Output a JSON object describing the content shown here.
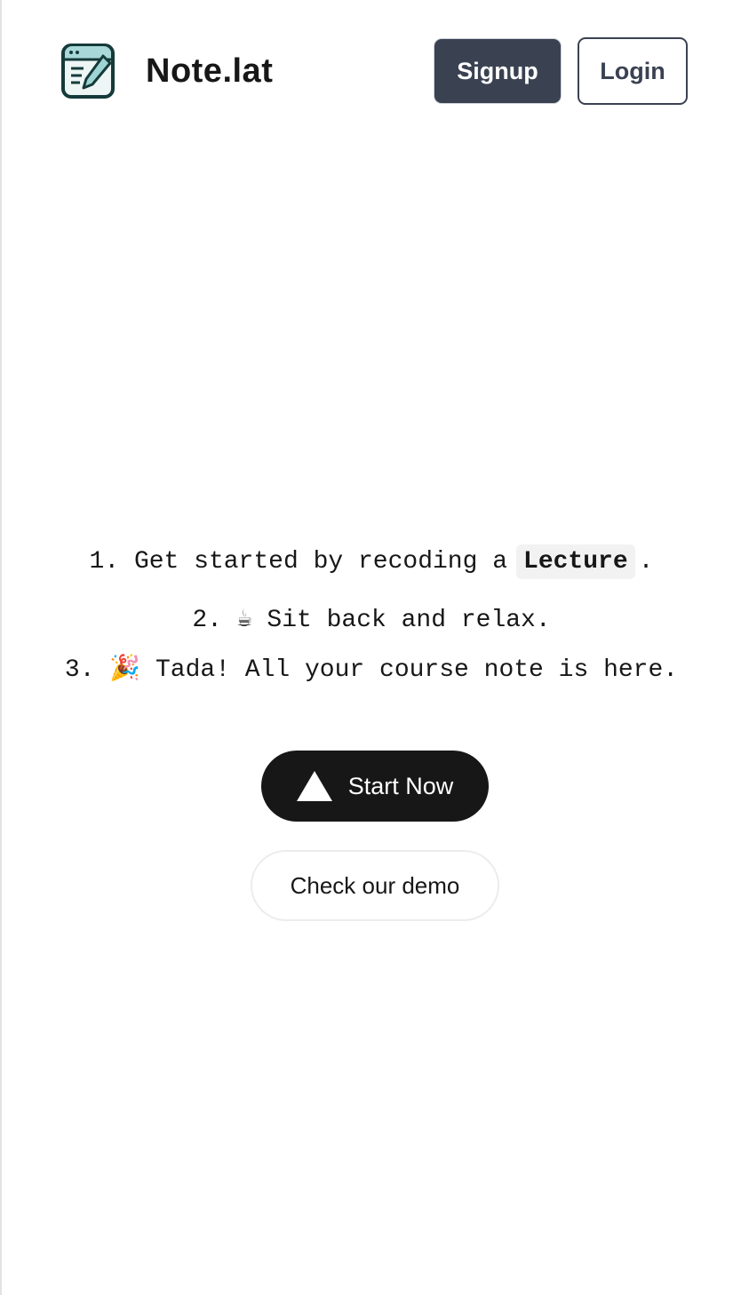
{
  "header": {
    "brand": "Note.lat",
    "signup_label": "Signup",
    "login_label": "Login"
  },
  "steps": {
    "step1_prefix": "1. Get started by recoding a",
    "step1_code": "Lecture",
    "step1_suffix": ".",
    "step2": "2. ☕ Sit back and relax.",
    "step3": "3. 🎉 Tada! All your course note is here."
  },
  "actions": {
    "start_label": "Start Now",
    "demo_label": "Check our demo"
  },
  "colors": {
    "primary_dark": "#3a4252",
    "cta": "#171717",
    "logo_accent": "#a8d8d8"
  }
}
